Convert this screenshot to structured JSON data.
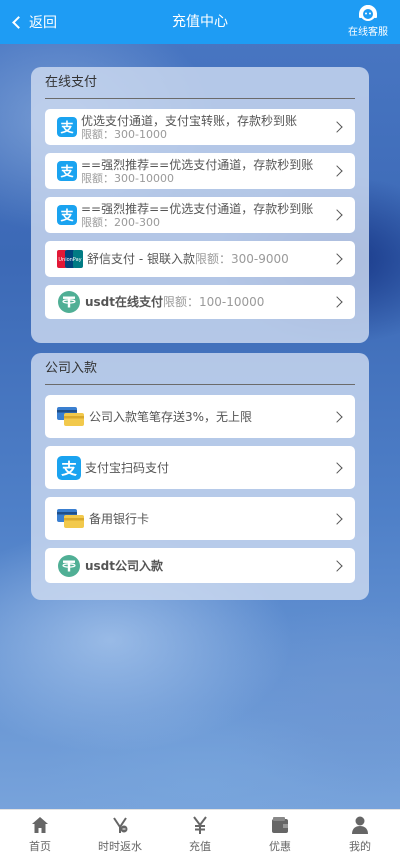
{
  "header": {
    "back_label": "返回",
    "title": "充值中心",
    "service_label": "在线客服"
  },
  "online": {
    "title": "在线支付",
    "items": [
      {
        "icon": "alipay-icon",
        "line1": "优选支付通道，支付宝转账，存款秒到账",
        "line2": "限额：300-1000"
      },
      {
        "icon": "alipay-icon",
        "line1": "==强烈推荐==优选支付通道，存款秒到账",
        "line2": "限额：300-10000"
      },
      {
        "icon": "alipay-icon",
        "line1": "==强烈推荐==优选支付通道，存款秒到账",
        "line2": "限额：200-300"
      },
      {
        "icon": "unionpay-icon",
        "main": "舒信支付 - 银联入款",
        "limit": "限额：300-9000"
      },
      {
        "icon": "tether-icon",
        "main": "usdt在线支付",
        "limit": "限额：100-10000"
      }
    ]
  },
  "company": {
    "title": "公司入款",
    "items": [
      {
        "icon": "bank-card-icon",
        "label": "公司入款笔笔存送3%，无上限"
      },
      {
        "icon": "alipay-icon",
        "label": "支付宝扫码支付"
      },
      {
        "icon": "bank-card-icon",
        "label": "备用银行卡"
      },
      {
        "icon": "tether-icon",
        "label": "usdt公司入款"
      }
    ]
  },
  "nav": {
    "items": [
      {
        "icon": "home-icon",
        "label": "首页"
      },
      {
        "icon": "rebate-icon",
        "label": "时时返水"
      },
      {
        "icon": "yen-icon",
        "label": "充值"
      },
      {
        "icon": "wallet-icon",
        "label": "优惠"
      },
      {
        "icon": "user-icon",
        "label": "我的"
      }
    ]
  },
  "colors": {
    "header": "#1e9cf4",
    "alipay": "#1aa3f0",
    "tether": "#50af95"
  }
}
